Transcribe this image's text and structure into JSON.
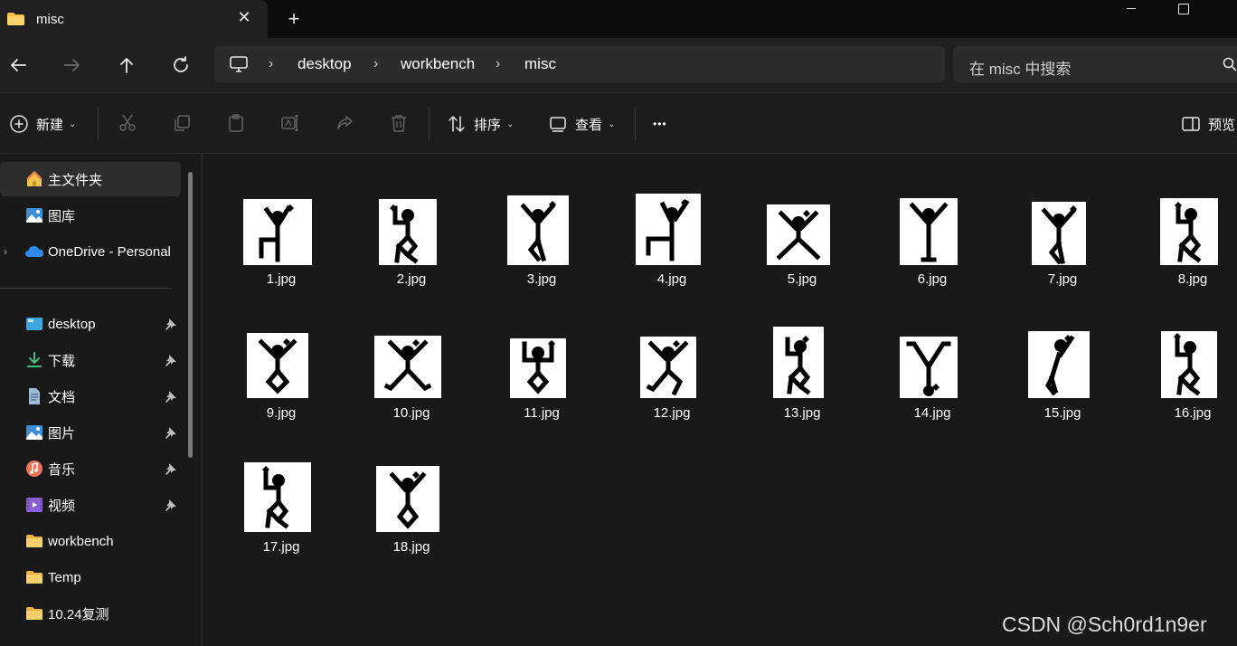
{
  "window": {
    "tab_title": "misc",
    "close_glyph": "✕",
    "new_tab_glyph": "+"
  },
  "address_bar": {
    "crumbs": [
      "desktop",
      "workbench",
      "misc"
    ],
    "separator": "›"
  },
  "search": {
    "placeholder": "在 misc 中搜索"
  },
  "toolbar": {
    "new_label": "新建",
    "sort_label": "排序",
    "view_label": "查看",
    "more_label": "•••",
    "preview_label": "预览"
  },
  "sidebar": {
    "items": [
      {
        "label": "主文件夹",
        "icon": "home-icon"
      },
      {
        "label": "图库",
        "icon": "gallery-icon"
      },
      {
        "label": "OneDrive - Personal",
        "icon": "onedrive-icon"
      },
      {
        "label": "desktop",
        "icon": "desktop-folder-icon"
      },
      {
        "label": "下载",
        "icon": "download-icon"
      },
      {
        "label": "文档",
        "icon": "document-icon"
      },
      {
        "label": "图片",
        "icon": "pictures-icon"
      },
      {
        "label": "音乐",
        "icon": "music-icon"
      },
      {
        "label": "视频",
        "icon": "video-icon"
      },
      {
        "label": "workbench",
        "icon": "folder-icon"
      },
      {
        "label": "Temp",
        "icon": "folder-icon"
      },
      {
        "label": "10.24复测",
        "icon": "folder-icon"
      }
    ]
  },
  "files": [
    {
      "name": "1.jpg"
    },
    {
      "name": "2.jpg"
    },
    {
      "name": "3.jpg"
    },
    {
      "name": "4.jpg"
    },
    {
      "name": "5.jpg"
    },
    {
      "name": "6.jpg"
    },
    {
      "name": "7.jpg"
    },
    {
      "name": "8.jpg"
    },
    {
      "name": "9.jpg"
    },
    {
      "name": "10.jpg"
    },
    {
      "name": "11.jpg"
    },
    {
      "name": "12.jpg"
    },
    {
      "name": "13.jpg"
    },
    {
      "name": "14.jpg"
    },
    {
      "name": "15.jpg"
    },
    {
      "name": "16.jpg"
    },
    {
      "name": "17.jpg"
    },
    {
      "name": "18.jpg"
    }
  ],
  "watermark": "CSDN @Sch0rd1n9er",
  "colors": {
    "background": "#191919",
    "titlebar": "#0c0c0c",
    "folder": "#f2c44b",
    "accent": "#4cc2ff"
  }
}
